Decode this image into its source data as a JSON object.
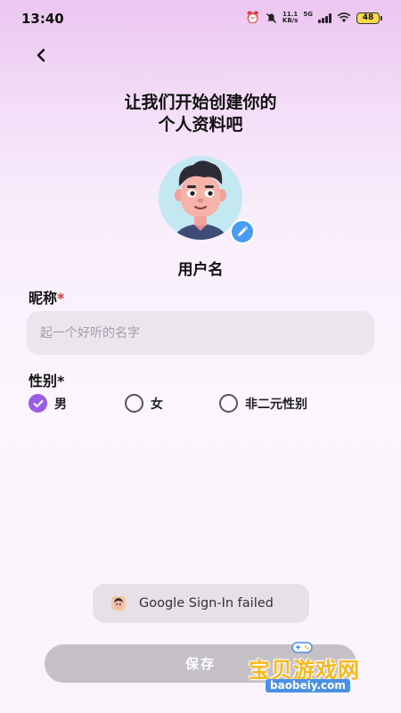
{
  "status_bar": {
    "time": "13:40",
    "net_speed_value": "11.1",
    "net_speed_unit": "KB/s",
    "network": "5G",
    "battery": "48"
  },
  "header": {
    "back_icon": "chevron-left-icon",
    "title_line1": "让我们开始创建你的",
    "title_line2": "个人资料吧"
  },
  "profile": {
    "avatar_icon": "cartoon-avatar",
    "edit_icon": "pencil-icon",
    "username": "用户名"
  },
  "form": {
    "nickname_label": "昵称",
    "required_mark": "*",
    "nickname_value": "",
    "nickname_placeholder": "起一个好听的名字",
    "gender_label": "性别*",
    "gender_options": [
      {
        "label": "男",
        "checked": true
      },
      {
        "label": "女",
        "checked": false
      },
      {
        "label": "非二元性别",
        "checked": false
      }
    ]
  },
  "toast": {
    "icon": "app-icon",
    "message": "Google Sign-In failed"
  },
  "actions": {
    "save_label": "保存"
  },
  "watermark": {
    "text": "宝贝游戏网",
    "url": "baobeiy.com"
  },
  "colors": {
    "accent": "#9b5de5",
    "edit_badge": "#4a9cf2",
    "required": "#d23b3b",
    "save_disabled": "#c4c0c6"
  }
}
